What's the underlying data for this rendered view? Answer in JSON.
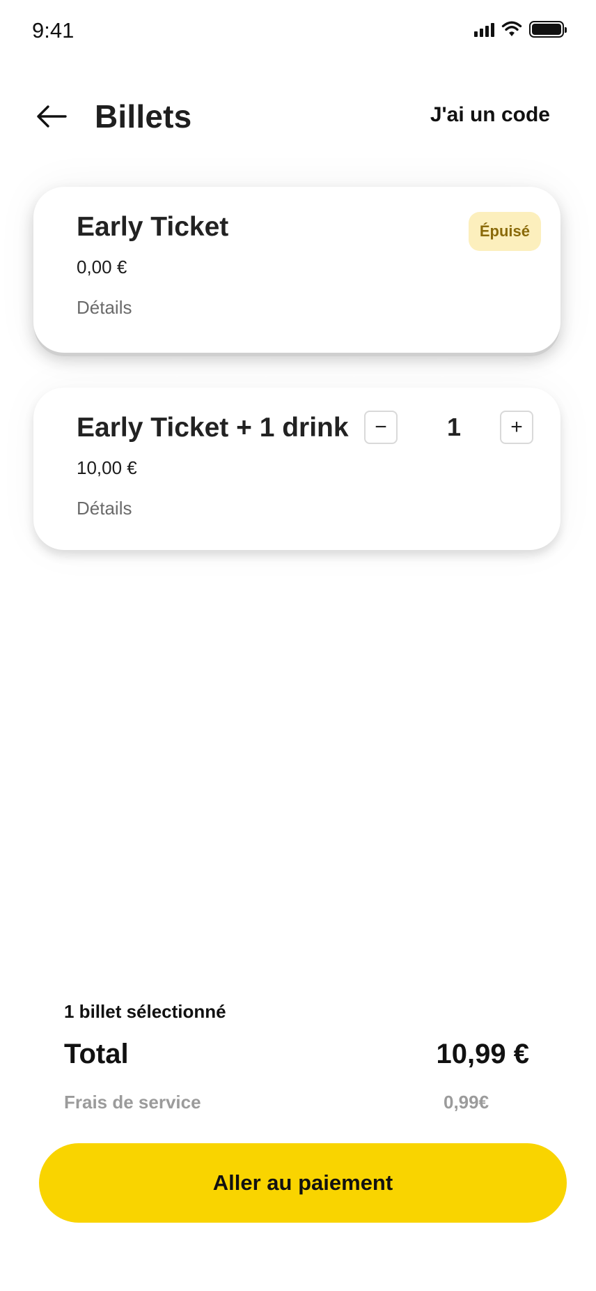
{
  "status_bar": {
    "time": "9:41",
    "icons": [
      "signal-icon",
      "wifi-icon",
      "battery-icon"
    ]
  },
  "header": {
    "title": "Billets",
    "back_icon": "arrow-left-icon",
    "code_link": "J'ai un code"
  },
  "tickets": [
    {
      "name": "Early Ticket",
      "price": "0,00 €",
      "details": "Détails",
      "badge": "Épuisé"
    },
    {
      "name": "Early Ticket + 1 drink",
      "price": "10,00 €",
      "details": "Détails",
      "quantity": "1",
      "minus": "−",
      "plus": "+"
    }
  ],
  "summary": {
    "selected": "1 billet sélectionné",
    "total_label": "Total",
    "total_value": "10,99 €",
    "fee_label": "Frais de service",
    "fee_value": "0,99€"
  },
  "cta": {
    "label": "Aller au paiement"
  },
  "colors": {
    "accent": "#f9d400",
    "badge_bg": "#fcefbd",
    "badge_text": "#8a6a0a"
  }
}
